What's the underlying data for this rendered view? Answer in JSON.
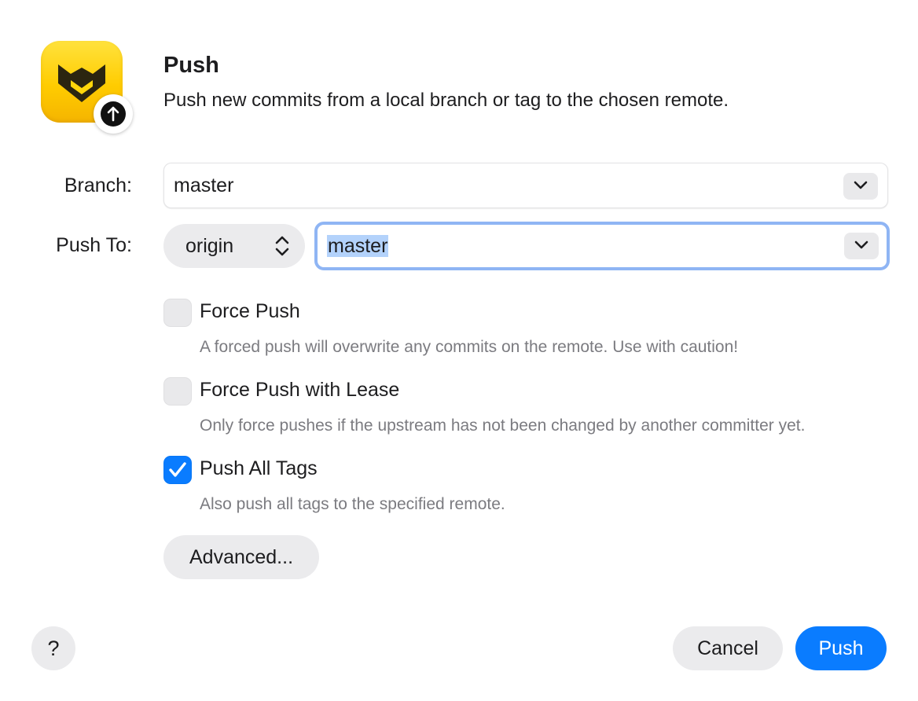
{
  "header": {
    "title": "Push",
    "subtitle": "Push new commits from a local branch or tag to the chosen remote.",
    "app_icon": "fork-app-icon",
    "badge_icon": "arrow-up-circle-icon"
  },
  "form": {
    "branch_label": "Branch:",
    "branch_value": "master",
    "push_to_label": "Push To:",
    "remote_value": "origin",
    "target_branch_value": "master"
  },
  "options": [
    {
      "label": "Force Push",
      "description": "A forced push will overwrite any commits on the remote. Use with caution!",
      "checked": false
    },
    {
      "label": "Force Push with Lease",
      "description": "Only force pushes if the upstream has not been changed by another committer yet.",
      "checked": false
    },
    {
      "label": "Push All Tags",
      "description": "Also push all tags to the specified remote.",
      "checked": true
    }
  ],
  "buttons": {
    "advanced": "Advanced...",
    "help": "?",
    "cancel": "Cancel",
    "push": "Push"
  },
  "colors": {
    "accent": "#0a7cff",
    "focus_ring": "#8fb5f4",
    "selection": "#b3d2fb",
    "app_icon": "#ffcc00"
  }
}
